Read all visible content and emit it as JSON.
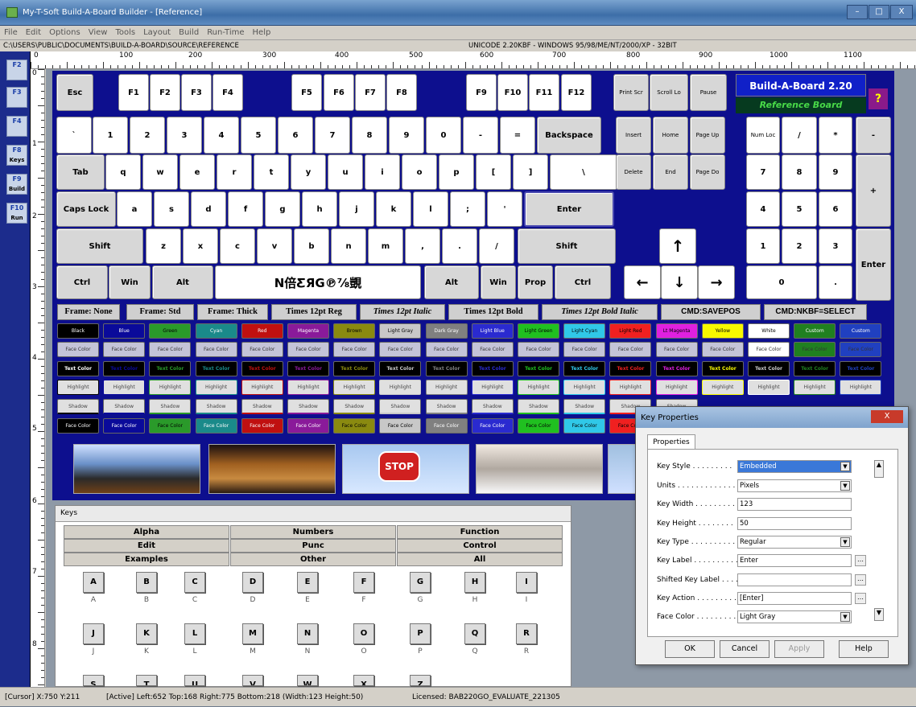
{
  "window": {
    "title": "My-T-Soft Build-A-Board Builder - [Reference]",
    "btn_min": "–",
    "btn_max": "□",
    "btn_close": "X"
  },
  "menu": [
    "File",
    "Edit",
    "Options",
    "View",
    "Tools",
    "Layout",
    "Build",
    "Run-Time",
    "Help"
  ],
  "path": {
    "left": "C:\\USERS\\PUBLIC\\DOCUMENTS\\BUILD-A-BOARD\\SOURCE\\REFERENCE",
    "right": "UNICODE 2.20KBF - WINDOWS 95/98/ME/NT/2000/XP - 32BIT"
  },
  "ruler": {
    "top": [
      "0",
      "100",
      "200",
      "300",
      "400",
      "500",
      "600",
      "700",
      "800",
      "900",
      "1000",
      "1100"
    ],
    "left": [
      "0",
      "1",
      "2",
      "3",
      "4",
      "5",
      "6",
      "7",
      "8"
    ]
  },
  "tools": [
    {
      "label": "F2",
      "sub": ""
    },
    {
      "label": "F3",
      "sub": ""
    },
    {
      "label": "F4",
      "sub": ""
    },
    {
      "label": "F8",
      "sub": "Keys"
    },
    {
      "label": "F9",
      "sub": "Build"
    },
    {
      "label": "F10",
      "sub": "Run"
    }
  ],
  "board": {
    "logo_title": "Build-A-Board 2.20",
    "logo_sub": "Reference Board",
    "help": "?",
    "row_f": [
      "Esc",
      "F1",
      "F2",
      "F3",
      "F4",
      "F5",
      "F6",
      "F7",
      "F8",
      "F9",
      "F10",
      "F11",
      "F12",
      "Print Scr",
      "Scroll Lo",
      "Pause"
    ],
    "row_num": [
      "`",
      "1",
      "2",
      "3",
      "4",
      "5",
      "6",
      "7",
      "8",
      "9",
      "0",
      "-",
      "=",
      "Backspace",
      "Insert",
      "Home",
      "Page Up",
      "Num Loc",
      "/",
      "*",
      "-"
    ],
    "row_tab": [
      "Tab",
      "q",
      "w",
      "e",
      "r",
      "t",
      "y",
      "u",
      "i",
      "o",
      "p",
      "[",
      "]",
      "\\",
      "Delete",
      "End",
      "Page Do",
      "7",
      "8",
      "9",
      "+"
    ],
    "row_caps": [
      "Caps Lock",
      "a",
      "s",
      "d",
      "f",
      "g",
      "h",
      "j",
      "k",
      "l",
      ";",
      "'",
      "Enter",
      "4",
      "5",
      "6"
    ],
    "row_shift": [
      "Shift",
      "z",
      "x",
      "c",
      "v",
      "b",
      "n",
      "m",
      ",",
      ".",
      "/",
      "Shift",
      "↑",
      "1",
      "2",
      "3",
      "Enter"
    ],
    "row_ctrl": [
      "Ctrl",
      "Win",
      "Alt",
      "N倍ƸЯG℗⅞覬",
      "Alt",
      "Win",
      "Prop",
      "Ctrl",
      "←",
      "↓",
      "→",
      "0",
      "."
    ],
    "frames": [
      "Frame: None",
      "Frame: Std",
      "Frame: Thick",
      "Times 12pt Reg",
      "Times 12pt Italic",
      "Times 12pt Bold",
      "Times 12pt Bold Italic",
      "CMD:SAVEPOS",
      "CMD:NKBF=SELECT"
    ],
    "colors": [
      {
        "name": "Black",
        "hex": "#000000"
      },
      {
        "name": "Blue",
        "hex": "#0a0a9a"
      },
      {
        "name": "Green",
        "hex": "#2a9a2a"
      },
      {
        "name": "Cyan",
        "hex": "#1a8a8a"
      },
      {
        "name": "Red",
        "hex": "#c01010"
      },
      {
        "name": "Magenta",
        "hex": "#8a1a9a"
      },
      {
        "name": "Brown",
        "hex": "#8a8a10"
      },
      {
        "name": "Light Gray",
        "hex": "#c8c8c8"
      },
      {
        "name": "Dark Gray",
        "hex": "#808080"
      },
      {
        "name": "Light Blue",
        "hex": "#2a2ad0"
      },
      {
        "name": "Light Green",
        "hex": "#20c020"
      },
      {
        "name": "Light Cyan",
        "hex": "#30c8e8"
      },
      {
        "name": "Light Red",
        "hex": "#f02020"
      },
      {
        "name": "Lt Magenta",
        "hex": "#e020e0"
      },
      {
        "name": "Yellow",
        "hex": "#f8f800"
      },
      {
        "name": "White",
        "hex": "#ffffff"
      },
      {
        "name": "Custom",
        "hex": "#208020"
      },
      {
        "name": "Custom",
        "hex": "#2040c0"
      }
    ],
    "face": "Face Color",
    "text": "Text Color",
    "highlight": "Highlight",
    "shadow": "Shadow",
    "stop": "STOP"
  },
  "keyspanel": {
    "title": "Keys",
    "cats": [
      "Alpha",
      "Numbers",
      "Function",
      "Edit",
      "Punc",
      "Control",
      "Examples",
      "Other",
      "All"
    ],
    "keys": [
      "A",
      "B",
      "C",
      "D",
      "E",
      "F",
      "G",
      "H",
      "I",
      "J",
      "K",
      "L",
      "M",
      "N",
      "O",
      "P",
      "Q",
      "R",
      "S",
      "T",
      "U",
      "V",
      "W",
      "X",
      "Z"
    ],
    "labels": [
      "A",
      "B",
      "C",
      "D",
      "E",
      "F",
      "G",
      "H",
      "I",
      "J",
      "K",
      "L",
      "M",
      "N",
      "O",
      "P",
      "Q",
      "R"
    ]
  },
  "dialog": {
    "title": "Key Properties",
    "tab": "Properties",
    "rows": [
      {
        "k": "Key Style . . . . . . . . .",
        "v": "Embedded"
      },
      {
        "k": "Units . . . . . . . . . . . . .",
        "v": "Pixels"
      },
      {
        "k": "Key Width . . . . . . . . .",
        "v": "123"
      },
      {
        "k": "Key Height . . . . . . . .",
        "v": "50"
      },
      {
        "k": "Key Type . . . . . . . . . .",
        "v": "Regular"
      },
      {
        "k": "Key Label . . . . . . . . . .",
        "v": "Enter"
      },
      {
        "k": "Shifted Key Label . . . .",
        "v": ""
      },
      {
        "k": "Key Action . . . . . . . . .",
        "v": "[Enter]"
      },
      {
        "k": "Face Color . . . . . . . . .",
        "v": "Light Gray"
      }
    ],
    "ok": "OK",
    "cancel": "Cancel",
    "apply": "Apply",
    "help": "Help"
  },
  "status": {
    "cursor": "[Cursor] X:750 Y:211",
    "active": "[Active] Left:652 Top:168 Right:775 Bottom:218 (Width:123 Height:50)",
    "license": "Licensed: BAB220GO_EVALUATE_221305"
  }
}
